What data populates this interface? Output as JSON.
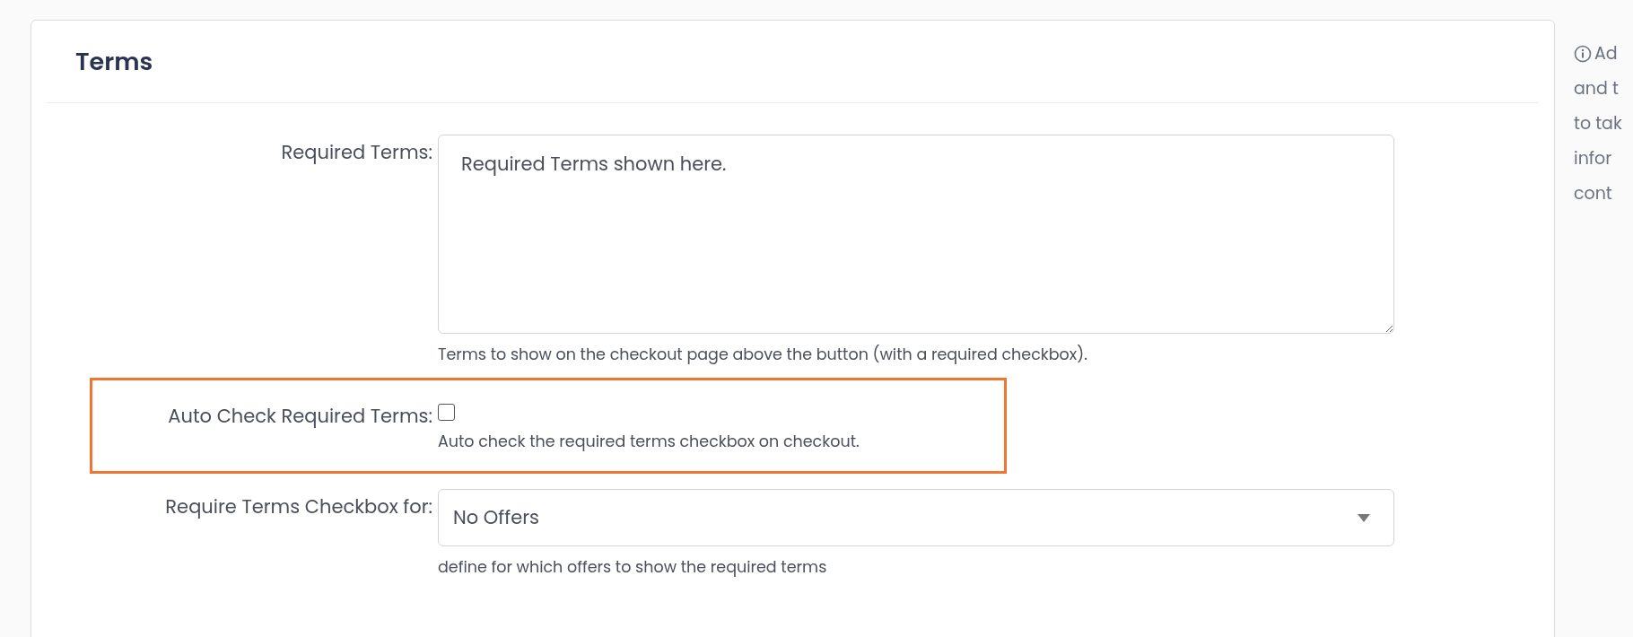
{
  "card": {
    "title": "Terms",
    "fields": [
      {
        "kind": "textarea",
        "label": "Required Terms:",
        "value": "Required Terms shown here.",
        "help": "Terms to show on the checkout page above the button (with a required checkbox).",
        "highlighted": false
      },
      {
        "kind": "checkbox",
        "label": "Auto Check Required Terms:",
        "checked": false,
        "help": "Auto check the required terms checkbox on checkout.",
        "highlighted": true
      },
      {
        "kind": "select",
        "label": "Require Terms Checkbox for:",
        "value": "No Offers",
        "help": "define for which offers to show the required terms",
        "highlighted": false
      }
    ]
  },
  "side_note": {
    "lines": [
      "Ad",
      "and t",
      "to tak",
      "infor",
      "cont"
    ]
  }
}
